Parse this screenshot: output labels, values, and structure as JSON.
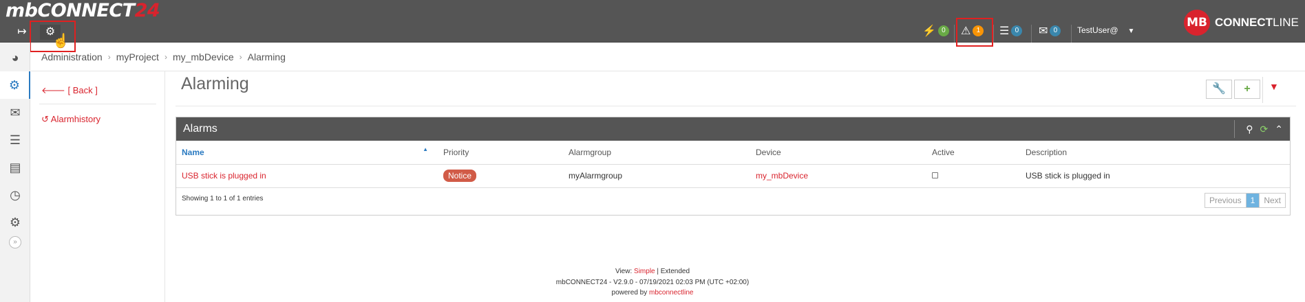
{
  "header": {
    "logo_main": "mbCONNECT",
    "logo_num": "24",
    "expand_icon": "↦",
    "settings_icon": "⚙",
    "status": [
      {
        "icon": "bolt",
        "glyph": "⚡",
        "count": "0",
        "color": "green"
      },
      {
        "icon": "warning",
        "glyph": "⚠",
        "count": "1",
        "color": "orange"
      },
      {
        "icon": "server",
        "glyph": "☰",
        "count": "0",
        "color": "blue"
      },
      {
        "icon": "envelope",
        "glyph": "✉",
        "count": "0",
        "color": "blue"
      }
    ],
    "user": "TestUser@",
    "brand_badge": "MB",
    "brand_connect": "CONNECT",
    "brand_line": "LINE"
  },
  "rail": {
    "icons": [
      "dashboard-icon",
      "cogs-icon",
      "envelope-icon",
      "server-icon",
      "book-icon",
      "clock-icon",
      "gear-icon"
    ],
    "collapse": "»"
  },
  "breadcrumb": [
    "Administration",
    "myProject",
    "my_mbDevice",
    "Alarming"
  ],
  "subnav": {
    "back": "[ Back ]",
    "alarmhistory": "Alarmhistory"
  },
  "page": {
    "title": "Alarming"
  },
  "widget": {
    "title": "Alarms",
    "columns": [
      "Name",
      "Priority",
      "Alarmgroup",
      "Device",
      "Active",
      "Description"
    ],
    "rows": [
      {
        "name": "USB stick is plugged in",
        "priority": "Notice",
        "alarmgroup": "myAlarmgroup",
        "device": "my_mbDevice",
        "active": false,
        "description": "USB stick is plugged in"
      }
    ],
    "info": "Showing 1 to 1 of 1 entries",
    "pager": {
      "prev": "Previous",
      "current": "1",
      "next": "Next"
    }
  },
  "footer": {
    "view_label": "View:",
    "view_simple": "Simple",
    "view_extended": "| Extended",
    "version": "mbCONNECT24 - V2.9.0 - 07/19/2021 02:03 PM (UTC +02:00)",
    "powered_label": "powered by",
    "powered_brand": "mbconnectline"
  },
  "colors": {
    "header_bg": "#555555",
    "accent_red": "#d9232d",
    "link_blue": "#2a7ac1",
    "badge_green": "#69aa46",
    "badge_orange": "#f89406",
    "badge_blue": "#3a87ad"
  }
}
